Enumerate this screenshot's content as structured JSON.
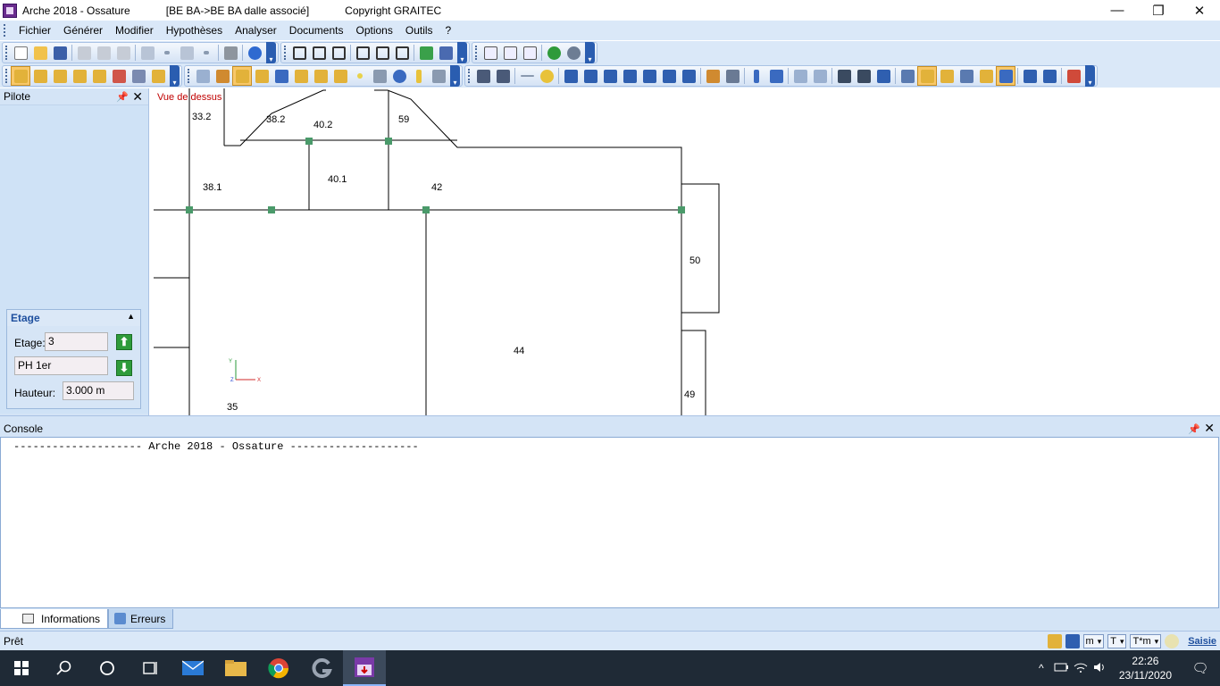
{
  "window": {
    "app_title": "Arche 2018 - Ossature",
    "doc_title": "[BE BA->BE BA dalle associé]",
    "copyright": "Copyright GRAITEC",
    "minimize": "—",
    "restore": "❐",
    "close": "✕"
  },
  "menu": [
    "Fichier",
    "Générer",
    "Modifier",
    "Hypothèses",
    "Analyser",
    "Documents",
    "Options",
    "Outils",
    "?"
  ],
  "pilot": {
    "title": "Pilote",
    "pin": "📌",
    "close": "✕"
  },
  "etage": {
    "title": "Etage",
    "collapse": "▲",
    "etage_label": "Etage:",
    "etage_value": "3",
    "name_value": "PH 1er",
    "hauteur_label": "Hauteur:",
    "hauteur_value": "3.000 m",
    "up_arrow": "⬆",
    "down_arrow": "⬇"
  },
  "canvas": {
    "view_label": "Vue de dessus",
    "slab_labels": [
      "33.2",
      "38.2",
      "40.2",
      "59",
      "38.1",
      "40.1",
      "42",
      "50",
      "44",
      "49",
      "35"
    ],
    "axis_x": "X",
    "axis_y": "Y",
    "axis_z": "Z"
  },
  "console": {
    "title": "Console",
    "pin": "📌",
    "close": "✕",
    "line": "-------------------- Arche 2018 - Ossature --------------------",
    "tab_info": "Informations",
    "tab_errors": "Erreurs"
  },
  "status": {
    "text": "Prêt",
    "unit_length": "m",
    "unit_force": "T",
    "unit_moment": "T*m",
    "mode": "Saisie"
  },
  "taskbar": {
    "time": "22:26",
    "date": "23/11/2020",
    "tray_chevron": "^",
    "notification": "🗨"
  },
  "colors": {
    "accent": "#2a5db0",
    "panel_bg": "#d4e4f6",
    "node_green": "#4a9a6a",
    "view_label": "#c00000"
  }
}
